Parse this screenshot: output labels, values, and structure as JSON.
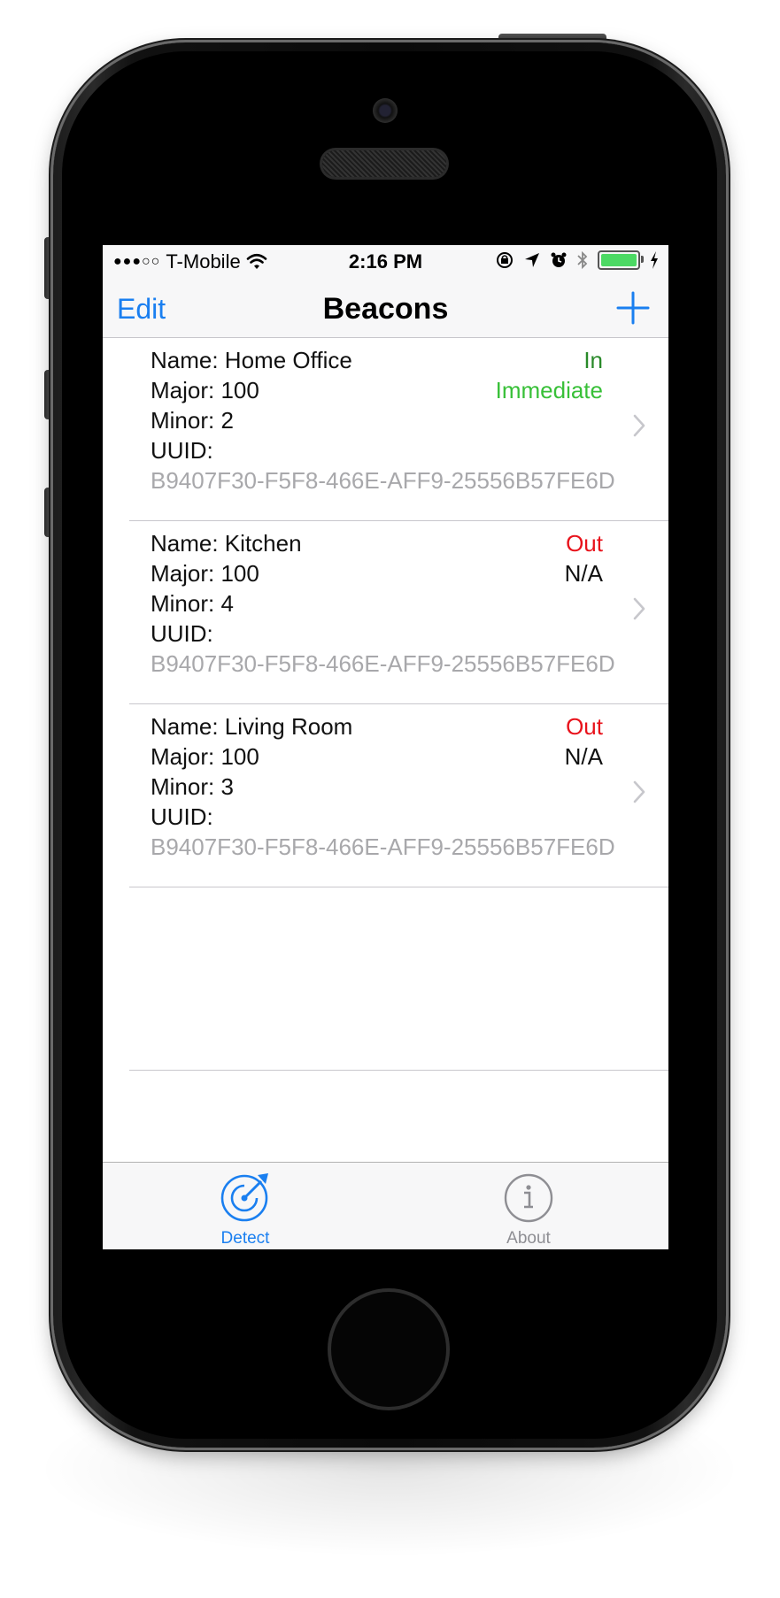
{
  "status_bar": {
    "signal": "●●●○○",
    "carrier": "T-Mobile",
    "time": "2:16 PM",
    "battery_level": 1.0
  },
  "nav": {
    "edit_label": "Edit",
    "title": "Beacons"
  },
  "beacons": [
    {
      "name": "Name: Home Office",
      "major": "Major: 100",
      "minor": "Minor: 2",
      "uuid_label": "UUID:",
      "uuid": "B9407F30-F5F8-466E-AFF9-25556B57FE6D",
      "state": "In",
      "proximity": "Immediate",
      "state_color": "#2a8a2a",
      "proximity_color": "#38c038"
    },
    {
      "name": "Name: Kitchen",
      "major": "Major: 100",
      "minor": "Minor: 4",
      "uuid_label": "UUID:",
      "uuid": "B9407F30-F5F8-466E-AFF9-25556B57FE6D",
      "state": "Out",
      "proximity": "N/A",
      "state_color": "#e8121b",
      "proximity_color": "#111111"
    },
    {
      "name": "Name: Living Room",
      "major": "Major: 100",
      "minor": "Minor: 3",
      "uuid_label": "UUID:",
      "uuid": "B9407F30-F5F8-466E-AFF9-25556B57FE6D",
      "state": "Out",
      "proximity": "N/A",
      "state_color": "#e8121b",
      "proximity_color": "#111111"
    }
  ],
  "tabs": [
    {
      "label": "Detect",
      "icon": "radar-icon",
      "active": true
    },
    {
      "label": "About",
      "icon": "info-icon",
      "active": false
    }
  ],
  "colors": {
    "accent": "#1a7ff0",
    "inactive_tab": "#8e8e93",
    "battery": "#4cd964"
  }
}
